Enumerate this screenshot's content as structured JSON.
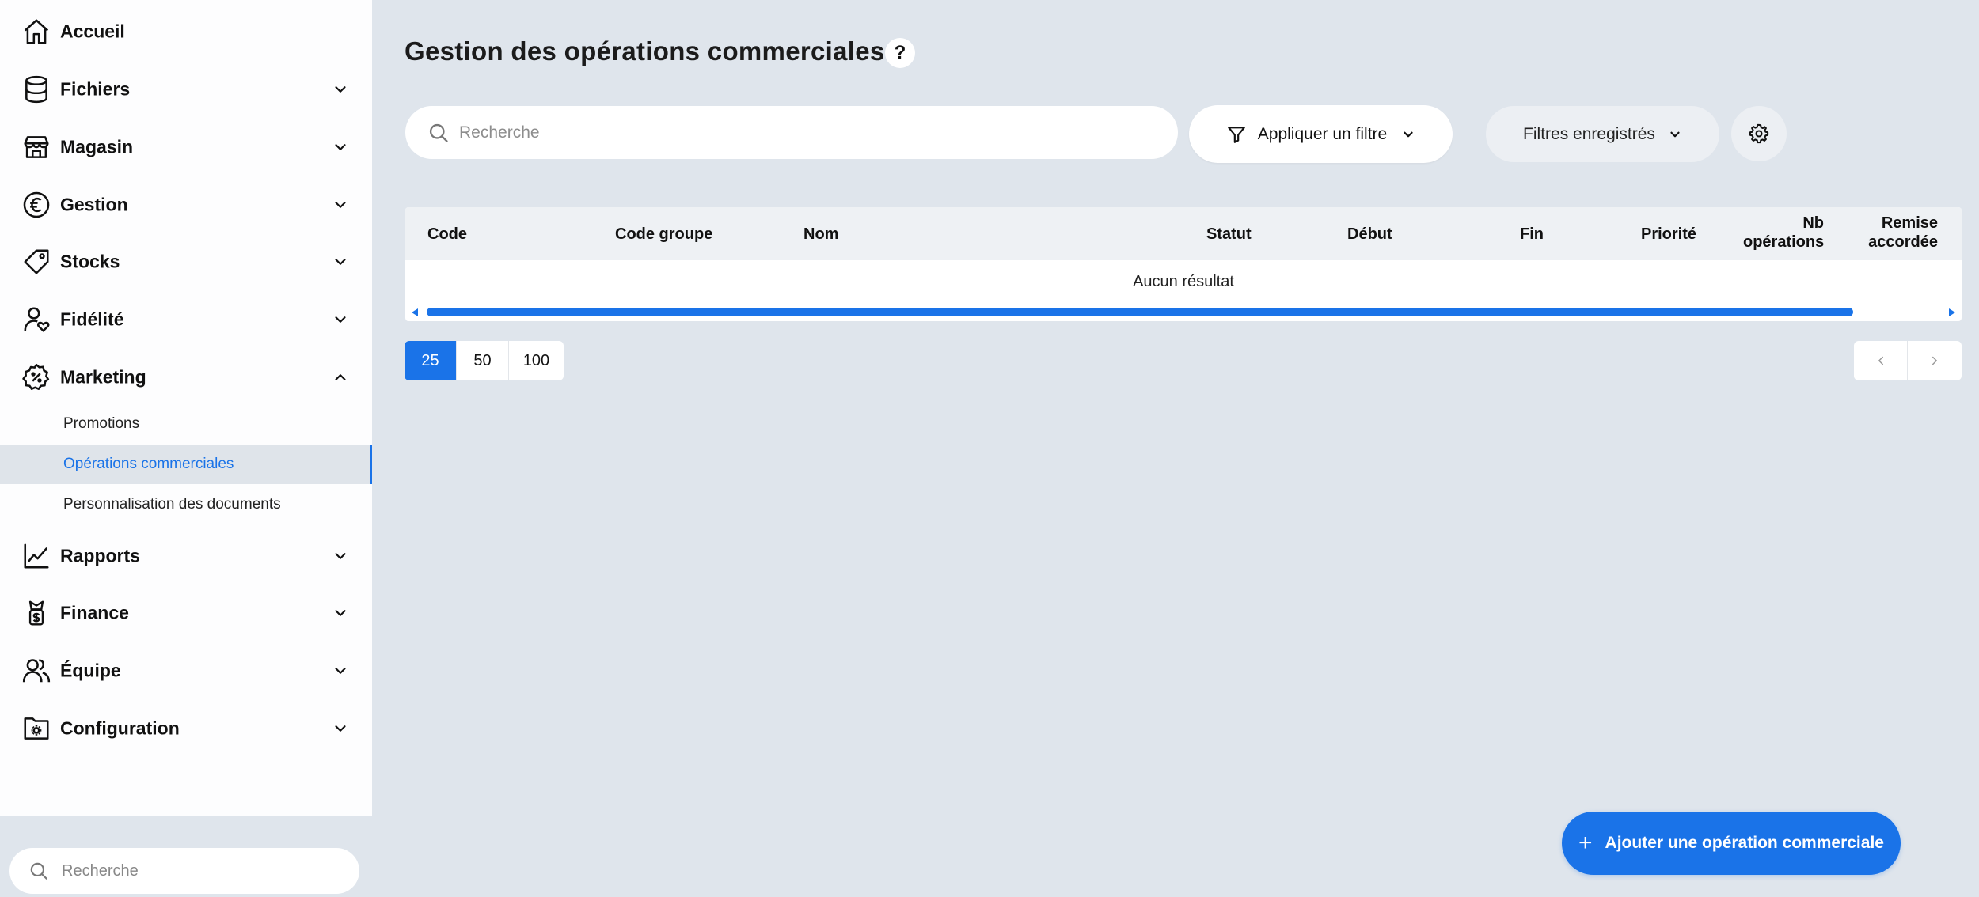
{
  "sidebar": {
    "items": [
      {
        "id": "accueil",
        "label": "Accueil",
        "icon": "home-icon",
        "expandable": false
      },
      {
        "id": "fichiers",
        "label": "Fichiers",
        "icon": "database-icon",
        "expandable": true
      },
      {
        "id": "magasin",
        "label": "Magasin",
        "icon": "store-icon",
        "expandable": true
      },
      {
        "id": "gestion",
        "label": "Gestion",
        "icon": "euro-icon",
        "expandable": true
      },
      {
        "id": "stocks",
        "label": "Stocks",
        "icon": "tag-icon",
        "expandable": true
      },
      {
        "id": "fidelite",
        "label": "Fidélité",
        "icon": "user-heart-icon",
        "expandable": true
      },
      {
        "id": "marketing",
        "label": "Marketing",
        "icon": "discount-badge-icon",
        "expandable": true,
        "expanded": true
      },
      {
        "id": "rapports",
        "label": "Rapports",
        "icon": "line-chart-icon",
        "expandable": true
      },
      {
        "id": "finance",
        "label": "Finance",
        "icon": "money-icon",
        "expandable": true
      },
      {
        "id": "equipe",
        "label": "Équipe",
        "icon": "team-icon",
        "expandable": true
      },
      {
        "id": "configuration",
        "label": "Configuration",
        "icon": "settings-folder-icon",
        "expandable": true
      }
    ],
    "marketing_subitems": [
      {
        "label": "Promotions",
        "active": false
      },
      {
        "label": "Opérations commerciales",
        "active": true
      },
      {
        "label": "Personnalisation des documents",
        "active": false
      }
    ],
    "search_placeholder": "Recherche"
  },
  "header": {
    "title": "Gestion des opérations commerciales",
    "help_label": "?"
  },
  "toolbar": {
    "search_placeholder": "Recherche",
    "filter_label": "Appliquer un filtre",
    "saved_filters_label": "Filtres enregistrés"
  },
  "table": {
    "columns": {
      "code": "Code",
      "code_groupe": "Code groupe",
      "nom": "Nom",
      "statut": "Statut",
      "debut": "Début",
      "fin": "Fin",
      "priorite": "Priorité",
      "nb_operations_1": "Nb",
      "nb_operations_2": "opérations",
      "remise_1": "Remise",
      "remise_2": "accordée"
    },
    "empty_message": "Aucun résultat"
  },
  "pagination": {
    "page_sizes": [
      "25",
      "50",
      "100"
    ],
    "selected_page_size": "25"
  },
  "add_button_label": "Ajouter une opération commerciale",
  "colors": {
    "accent": "#1a73e8",
    "background": "#dfe5ec",
    "sidebar": "#fdfdfe"
  }
}
